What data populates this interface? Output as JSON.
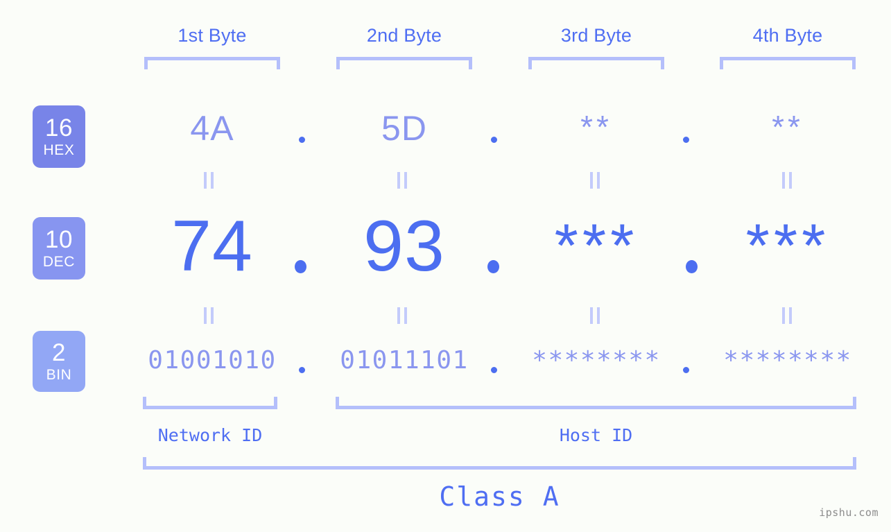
{
  "meta": {
    "background": "#fbfdf9",
    "accent": "#4c6ef0",
    "accent_light": "#8a96ef",
    "bracket_color": "#b4bffb",
    "watermark": "ipshu.com"
  },
  "byte_headers": [
    {
      "label": "1st Byte"
    },
    {
      "label": "2nd Byte"
    },
    {
      "label": "3rd Byte"
    },
    {
      "label": "4th Byte"
    }
  ],
  "rows": [
    {
      "badge_num": "16",
      "badge_unit": "HEX",
      "badge_color": "#7884e8",
      "values": [
        "4A",
        "5D",
        "**",
        "**"
      ],
      "masked": [
        false,
        false,
        true,
        true
      ]
    },
    {
      "badge_num": "10",
      "badge_unit": "DEC",
      "badge_color": "#8795f0",
      "values": [
        "74",
        "93",
        "***",
        "***"
      ],
      "masked": [
        false,
        false,
        true,
        true
      ]
    },
    {
      "badge_num": "2",
      "badge_unit": "BIN",
      "badge_color": "#92a7f5",
      "values": [
        "01001010",
        "01011101",
        "********",
        "********"
      ],
      "masked": [
        false,
        false,
        true,
        true
      ]
    }
  ],
  "separators": {
    "hex": ".",
    "dec": ".",
    "bin": "."
  },
  "sections": {
    "network_id": "Network ID",
    "host_id": "Host ID",
    "class": "Class A"
  }
}
